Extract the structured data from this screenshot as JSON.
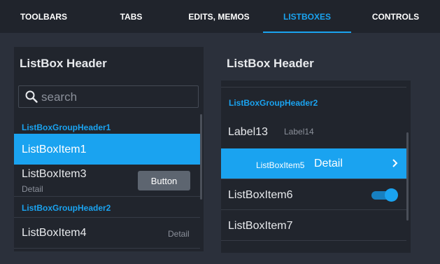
{
  "tabs": [
    {
      "label": "TOOLBARS"
    },
    {
      "label": "TABS"
    },
    {
      "label": "EDITS, MEMOS"
    },
    {
      "label": "LISTBOXES"
    },
    {
      "label": "CONTROLS"
    }
  ],
  "active_tab": "LISTBOXES",
  "accent_color": "#1aa3f0",
  "left": {
    "header": "ListBox Header",
    "search": {
      "placeholder": "search",
      "value": "",
      "icon": "search-icon"
    },
    "group1": "ListBoxGroupHeader1",
    "item1": "ListBoxItem1",
    "item3": {
      "text": "ListBoxItem3",
      "detail": "Detail",
      "button": "Button"
    },
    "group2": "ListBoxGroupHeader2",
    "item4": {
      "text": "ListBoxItem4",
      "detail": "Detail"
    }
  },
  "right": {
    "header": "ListBox Header",
    "group2": "ListBoxGroupHeader2",
    "label13": "Label13",
    "label14": "Label14",
    "item5": {
      "text": "ListBoxItem5",
      "detail": "Detail",
      "accessory": "chevron-right-icon"
    },
    "item6": {
      "text": "ListBoxItem6",
      "switch_on": true
    },
    "item7": "ListBoxItem7"
  }
}
